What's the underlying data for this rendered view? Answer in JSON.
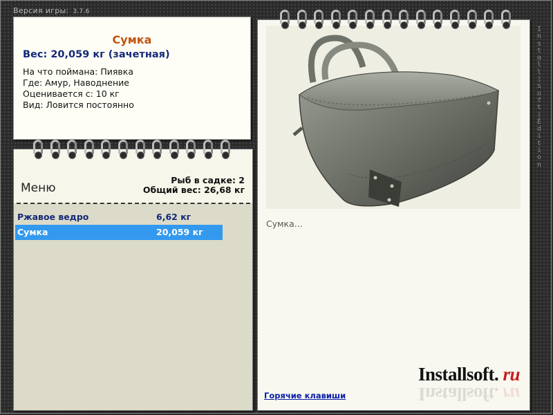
{
  "header": {
    "version_label": "Версия игры:",
    "version_number": "3.7.6"
  },
  "side_caption": "Install soft Edition",
  "fish_card": {
    "title": "Сумка",
    "weight_line": "Вес: 20,059 кг (зачетная)",
    "caught_on": "На что поймана: Пиявка",
    "location": "Где: Амур, Наводнение",
    "value": "Оценивается с: 10 кг",
    "kind": "Вид: Ловится постоянно"
  },
  "menu": {
    "title": "Меню",
    "fish_count": "Рыб в садке: 2",
    "total_weight": "Общий вес: 26,68 кг",
    "items": [
      {
        "name": "Ржавое ведро",
        "weight": "6,62 кг"
      },
      {
        "name": "Сумка",
        "weight": "20,059 кг"
      }
    ]
  },
  "detail": {
    "caption": "Сумка...",
    "hotkeys_link": "Горячие клавиши",
    "logo_main": "Installsoft.",
    "logo_ru": "ru"
  },
  "colors": {
    "accent_title": "#c25410",
    "weight_blue": "#14297a",
    "selection": "#3399ee",
    "link": "#0a1ea8"
  }
}
